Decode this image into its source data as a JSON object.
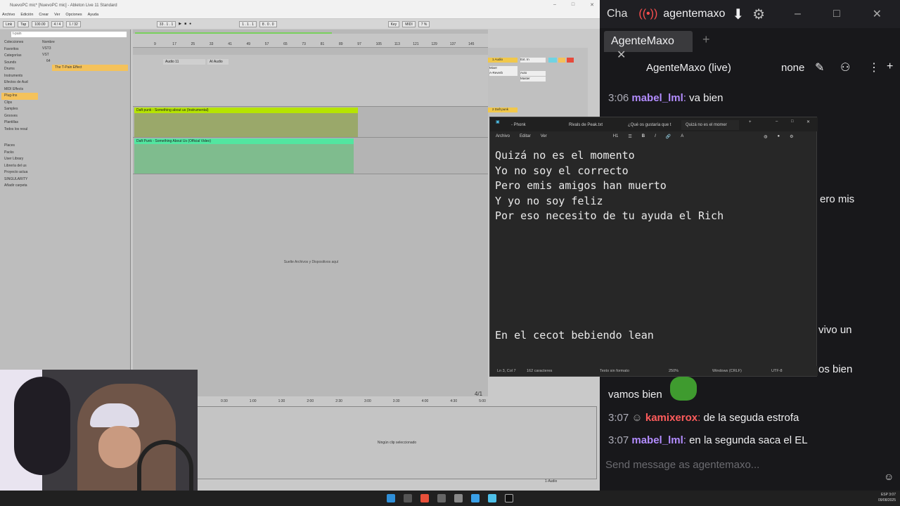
{
  "ableton": {
    "title": "NuevoPC mic* [NuevoPC mic] - Ableton Live 11 Standard",
    "menu": [
      "Archivo",
      "Edición",
      "Crear",
      "Ver",
      "Opciones",
      "Ayuda"
    ],
    "transport": {
      "link": "Link",
      "tap": "Tap",
      "tempo": "100.00",
      "sig": "4 / 4",
      "quant": "1 / 32",
      "pos": "33 . 1 . 1",
      "loop_start": "1 . 1 . 1",
      "loop_len": "8 . 0 . 0",
      "key": "Key",
      "midi": "MIDI",
      "cpu": "7 %"
    },
    "browser": {
      "search": "t-pain",
      "sections": [
        "Colecciones",
        "Favoritos",
        "Categorías",
        "Sounds",
        "Drums",
        "Instruments",
        "Efectos de Aud",
        "MIDI Effects",
        "Plug-Ins",
        "Clips",
        "Samples",
        "Grooves",
        "Plantillas",
        "Todos los resul",
        "Places",
        "Packs",
        "User Library",
        "Librería del us",
        "Proyecto actua",
        "SINGULARITY",
        "Añadir carpeta"
      ],
      "column_header": "Nombre",
      "items": [
        "VST3",
        "VST",
        "64",
        "The T-Pain Effect"
      ]
    },
    "ruler_ticks": [
      "9",
      "17",
      "25",
      "33",
      "41",
      "49",
      "57",
      "65",
      "73",
      "81",
      "89",
      "97",
      "105",
      "113",
      "121",
      "129",
      "137",
      "145"
    ],
    "clips": [
      {
        "name": "Audio 11"
      },
      {
        "name": "AI Audio"
      },
      {
        "name": "Daft punk - Something about us (Instrumental)"
      },
      {
        "name": "Daft Punk - Something About Us (Official Video)"
      }
    ],
    "drop_hint": "Suelte Archivos y Dispositivos aquí",
    "mixer": {
      "track1": "1 Audio",
      "track2": "2 Daft punk",
      "input": "Ext. In",
      "monitor": "Auto",
      "send": "Master",
      "fx": "A-Reverb",
      "mixer_label": "Mixer"
    },
    "bottom_ruler": [
      "0:30",
      "1:00",
      "1:30",
      "2:00",
      "2:30",
      "3:00",
      "3:30",
      "4:00",
      "4:30",
      "5:00",
      "5:30"
    ],
    "detail_hint": "Ningún clip seleccionado",
    "bar_counter": "4/1",
    "track_label": "1-Audio"
  },
  "chat": {
    "tab_title_cut": "Cha",
    "channel": "agentemaxo",
    "tab": "AgenteMaxo",
    "header_name": "AgenteMaxo (live)",
    "header_mode": "none",
    "messages": [
      {
        "time": "3:06",
        "user": "mabel_lml",
        "text": "va bien",
        "color": "#b28cff"
      },
      {
        "time": "",
        "user": "",
        "text": "ero mis",
        "color": ""
      },
      {
        "time": "",
        "user": "",
        "text": "vivo un",
        "color": ""
      },
      {
        "time": "",
        "user": "",
        "text": "os bien",
        "color": ""
      },
      {
        "time": "",
        "user": "",
        "text": "vamos bien",
        "color": ""
      },
      {
        "time": "3:07",
        "user": "kamixerox",
        "text": "de la seguda estrofa",
        "color": "#ff5c5c"
      },
      {
        "time": "3:07",
        "user": "mabel_lml",
        "text": "en la segunda saca el EL",
        "color": "#b28cff"
      }
    ],
    "input_placeholder": "Send message as agentemaxo..."
  },
  "notepad": {
    "tabs": [
      "- Phonk",
      "Rivals de Peak.txt",
      "¿Qué os gustaría que t",
      "Quizá no es el momer"
    ],
    "menu": [
      "Archivo",
      "Editar",
      "Ver"
    ],
    "heading": "H1",
    "lines": [
      "Quizá no es el momento",
      "Yo no soy el correcto",
      "Pero emis amigos han muerto",
      "Y yo no soy feliz",
      "Por eso necesito de tu ayuda el Rich"
    ],
    "last_line": "En el cecot bebiendo lean",
    "status": {
      "pos": "Ln 3, Col 7",
      "chars": "162 caracteres",
      "format": "Texto sin formato",
      "zoom": "250%",
      "eol": "Windows (CRLF)",
      "enc": "UTF-8"
    }
  },
  "taskbar": {
    "lang": "ESP",
    "time": "3:07",
    "date": "09/08/2025"
  }
}
